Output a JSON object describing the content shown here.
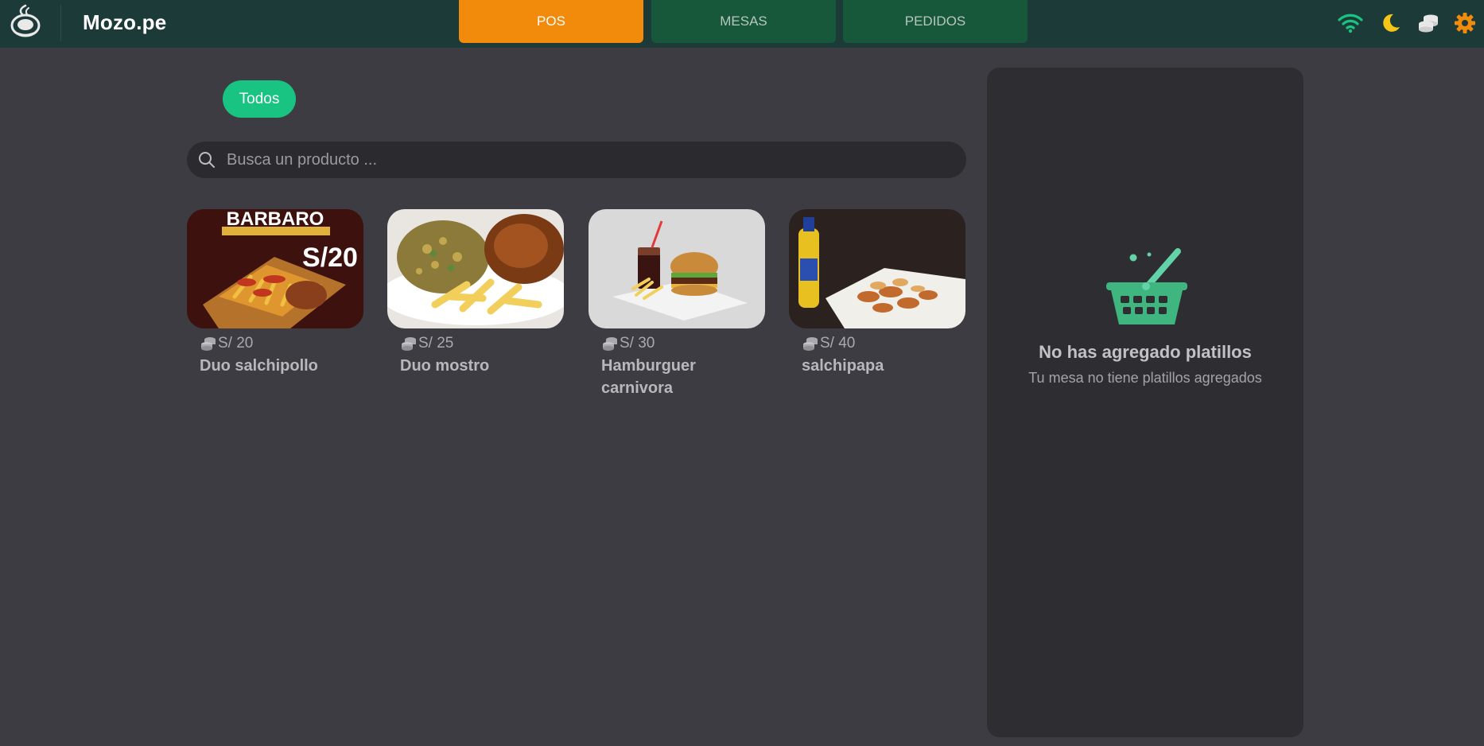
{
  "app": {
    "brand": "Mozo.pe",
    "logo_icon": "chef-hat-icon"
  },
  "tabs": [
    {
      "label": "POS",
      "active": true
    },
    {
      "label": "MESAS",
      "active": false
    },
    {
      "label": "PEDIDOS",
      "active": false
    }
  ],
  "toolbar": {
    "icons": [
      "wifi-icon",
      "moon-icon",
      "coins-icon",
      "gear-icon"
    ],
    "colors": {
      "wifi": "#19c482",
      "moon": "#f5c518",
      "coins": "#e8e8e8",
      "gear": "#f28a0b"
    }
  },
  "categories": [
    {
      "label": "Todos",
      "active": true
    }
  ],
  "search": {
    "placeholder": "Busca un producto ...",
    "value": ""
  },
  "products": [
    {
      "price": "S/ 20",
      "name": "Duo salchipollo",
      "image_text": "BARBARO",
      "image_price": "S/20"
    },
    {
      "price": "S/ 25",
      "name": "Duo mostro"
    },
    {
      "price": "S/ 30",
      "name": "Hamburguer carnivora"
    },
    {
      "price": "S/ 40",
      "name": "salchipapa"
    }
  ],
  "cart": {
    "empty_title": "No has agregado platillos",
    "empty_subtitle": "Tu mesa no tiene platillos agregados",
    "icon": "basket-icon"
  },
  "colors": {
    "accent_orange": "#f28a0b",
    "accent_green": "#19c482",
    "header_bg": "#1c3b38",
    "tab_inactive": "#17573a"
  }
}
